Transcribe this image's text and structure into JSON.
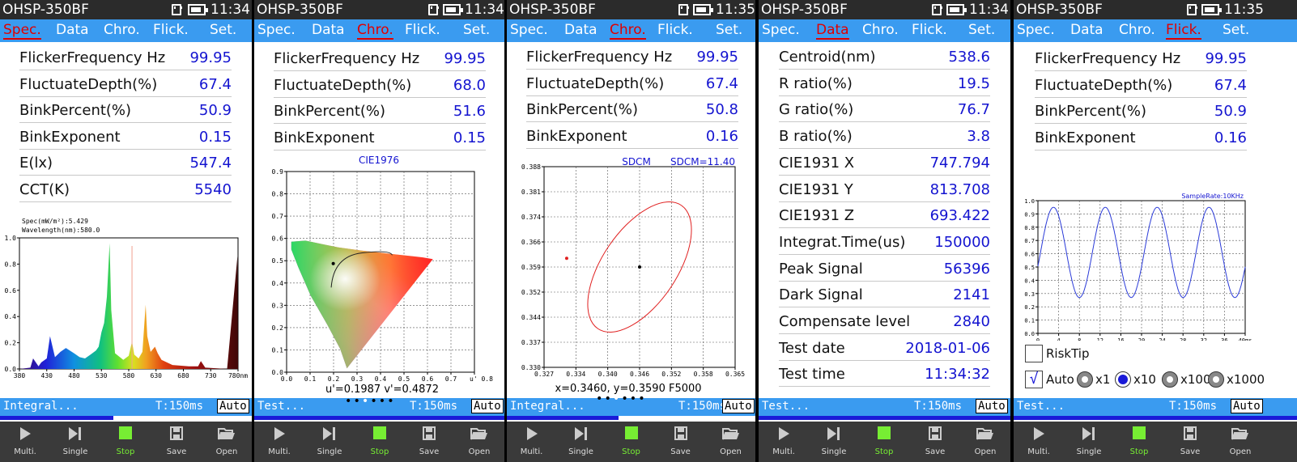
{
  "device_name": "OHSP-350BF",
  "screens": [
    {
      "time": "11:34",
      "tabs": [
        "Spec.",
        "Data",
        "Chro.",
        "Flick.",
        "Set."
      ],
      "active_tab": 0,
      "rows": [
        {
          "label": "FlickerFrequency Hz",
          "value": "99.95"
        },
        {
          "label": "FluctuateDepth(%)",
          "value": "67.4"
        },
        {
          "label": "BinkPercent(%)",
          "value": "50.9"
        },
        {
          "label": "BinkExponent",
          "value": "0.15"
        },
        {
          "label": "E(lx)",
          "value": "547.4"
        },
        {
          "label": "CCT(K)",
          "value": "5540"
        }
      ],
      "status": "Integral...",
      "time_label": "T:150ms",
      "auto_label": "Auto",
      "progress": 0.45
    },
    {
      "time": "11:34",
      "tabs": [
        "Spec.",
        "Data",
        "Chro.",
        "Flick.",
        "Set."
      ],
      "active_tab": 2,
      "rows": [
        {
          "label": "FlickerFrequency Hz",
          "value": "99.95"
        },
        {
          "label": "FluctuateDepth(%)",
          "value": "68.0"
        },
        {
          "label": "BinkPercent(%)",
          "value": "51.6"
        },
        {
          "label": "BinkExponent",
          "value": "0.15"
        }
      ],
      "status": "Test...",
      "time_label": "T:150ms",
      "auto_label": "Auto",
      "progress": 1.0
    },
    {
      "time": "11:35",
      "tabs": [
        "Spec.",
        "Data",
        "Chro.",
        "Flick.",
        "Set."
      ],
      "active_tab": 2,
      "rows": [
        {
          "label": "FlickerFrequency Hz",
          "value": "99.95"
        },
        {
          "label": "FluctuateDepth(%)",
          "value": "67.4"
        },
        {
          "label": "BinkPercent(%)",
          "value": "50.8"
        },
        {
          "label": "BinkExponent",
          "value": "0.16"
        }
      ],
      "status": "Integral...",
      "time_label": "T:150ms",
      "auto_label": "Auto",
      "progress": 0.45
    },
    {
      "time": "11:34",
      "tabs": [
        "Spec.",
        "Data",
        "Chro.",
        "Flick.",
        "Set."
      ],
      "active_tab": 1,
      "rows": [
        {
          "label": "Centroid(nm)",
          "value": "538.6"
        },
        {
          "label": "R ratio(%)",
          "value": "19.5"
        },
        {
          "label": "G ratio(%)",
          "value": "76.7"
        },
        {
          "label": "B ratio(%)",
          "value": "3.8"
        },
        {
          "label": "CIE1931 X",
          "value": "747.794"
        },
        {
          "label": "CIE1931 Y",
          "value": "813.708"
        },
        {
          "label": "CIE1931 Z",
          "value": "693.422"
        },
        {
          "label": "Integrat.Time(us)",
          "value": "150000"
        },
        {
          "label": "Peak Signal",
          "value": "56396"
        },
        {
          "label": "Dark Signal",
          "value": "2141"
        },
        {
          "label": "Compensate level",
          "value": "2840"
        },
        {
          "label": "Test date",
          "value": "2018-01-06"
        },
        {
          "label": "Test time",
          "value": "11:34:32"
        }
      ],
      "status": "Test...",
      "time_label": "T:150ms",
      "auto_label": "Auto",
      "progress": 1.0
    },
    {
      "time": "11:35",
      "tabs": [
        "Spec.",
        "Data",
        "Chro.",
        "Flick.",
        "Set."
      ],
      "active_tab": 3,
      "rows": [
        {
          "label": "FlickerFrequency Hz",
          "value": "99.95"
        },
        {
          "label": "FluctuateDepth(%)",
          "value": "67.4"
        },
        {
          "label": "BinkPercent(%)",
          "value": "50.9"
        },
        {
          "label": "BinkExponent",
          "value": "0.16"
        }
      ],
      "status": "Test...",
      "time_label": "T:150ms",
      "auto_label": "Auto",
      "progress": 1.0,
      "risk_tip_label": "RiskTip",
      "auto_check_label": "Auto",
      "check_mark": "√",
      "zoom_options": [
        "x1",
        "x10",
        "x100",
        "x1000"
      ],
      "zoom_selected": 1
    }
  ],
  "toolbar": [
    {
      "label": "Multi.",
      "icon": "play-icon"
    },
    {
      "label": "Single",
      "icon": "step-icon"
    },
    {
      "label": "Stop",
      "icon": "stop-icon"
    },
    {
      "label": "Save",
      "icon": "save-icon"
    },
    {
      "label": "Open",
      "icon": "folder-open-icon"
    }
  ],
  "page_dots": [
    "•",
    "•",
    "•",
    "•",
    "•",
    "•"
  ],
  "page_dots_active": 2,
  "colors": {
    "tab_bar": "#3a9bf0",
    "active_tab": "#e00000",
    "value_text": "#1414d0",
    "stop_icon": "#77ee33",
    "flicker_curve": "#2a3ad8",
    "sdcm_ellipse": "#e02020"
  },
  "chart_data": [
    {
      "type": "line",
      "kind": "spectrum",
      "annotations": [
        "Spec(mW/m²):5.429",
        "Wavelength(nm):580.0"
      ],
      "x_ticks": [
        "380",
        "430",
        "480",
        "530",
        "580",
        "630",
        "680",
        "730",
        "780nm"
      ],
      "y_ticks": [
        "0.0",
        "0.2",
        "0.4",
        "0.6",
        "0.8",
        "1.0"
      ],
      "xlim": [
        380,
        780
      ],
      "ylim": [
        0,
        1.0
      ],
      "x": [
        380,
        400,
        405,
        415,
        420,
        430,
        436,
        445,
        455,
        465,
        480,
        490,
        500,
        510,
        520,
        525,
        530,
        535,
        540,
        545,
        548,
        555,
        570,
        580,
        586,
        590,
        598,
        605,
        611,
        614,
        620,
        628,
        633,
        640,
        660,
        690,
        707,
        712,
        720,
        760,
        779,
        780
      ],
      "y": [
        0.0,
        0.01,
        0.08,
        0.02,
        0.05,
        0.08,
        0.25,
        0.09,
        0.13,
        0.16,
        0.12,
        0.09,
        0.08,
        0.11,
        0.14,
        0.17,
        0.28,
        0.35,
        0.55,
        0.96,
        0.45,
        0.12,
        0.07,
        0.1,
        0.21,
        0.11,
        0.08,
        0.13,
        0.49,
        0.25,
        0.13,
        0.17,
        0.12,
        0.07,
        0.03,
        0.02,
        0.02,
        0.06,
        0.01,
        0.0,
        0.86,
        0.0
      ]
    },
    {
      "type": "scatter",
      "kind": "cie1976",
      "title": "CIE1976",
      "x_ticks": [
        "0.0",
        "0.1",
        "0.2",
        "0.3",
        "0.4",
        "0.5",
        "0.6",
        "0.7"
      ],
      "x_ticks_end": "u' 0.8",
      "y_ticks": [
        "0.0",
        "0.1",
        "0.2",
        "0.3",
        "0.4",
        "0.5",
        "0.6",
        "0.7",
        "0.8",
        "0.9"
      ],
      "xlim": [
        0,
        0.8
      ],
      "ylim": [
        0,
        0.9
      ],
      "point": {
        "u": 0.1987,
        "v": 0.4872
      },
      "caption": "u'=0.1987  v'=0.4872",
      "locus": [
        [
          0.257,
          0.017
        ],
        [
          0.228,
          0.105
        ],
        [
          0.172,
          0.215
        ],
        [
          0.102,
          0.344
        ],
        [
          0.05,
          0.47
        ],
        [
          0.02,
          0.55
        ],
        [
          0.02,
          0.585
        ],
        [
          0.08,
          0.59
        ],
        [
          0.15,
          0.575
        ],
        [
          0.22,
          0.56
        ],
        [
          0.32,
          0.545
        ],
        [
          0.45,
          0.53
        ],
        [
          0.58,
          0.515
        ],
        [
          0.623,
          0.507
        ]
      ]
    },
    {
      "type": "scatter",
      "kind": "sdcm",
      "title": "SDCM",
      "sdcm_label": "SDCM=11.40",
      "x_ticks": [
        "0.327",
        "0.334",
        "0.340",
        "0.346",
        "0.352",
        "0.358",
        "0.365"
      ],
      "y_ticks": [
        "0.388",
        "0.381",
        "0.374",
        "0.366",
        "0.359",
        "0.352",
        "0.344",
        "0.337",
        "0.330"
      ],
      "xlim": [
        0.327,
        0.365
      ],
      "ylim": [
        0.33,
        0.388
      ],
      "center": {
        "x": 0.346,
        "y": 0.359
      },
      "measured": {
        "x": 0.3315,
        "y": 0.3615
      },
      "caption": "x=0.3460, y=0.3590 F5000"
    },
    {
      "type": "line",
      "kind": "flicker",
      "sample_rate": "SampleRate:10KHz",
      "x_ticks": [
        "0",
        "4",
        "8",
        "12",
        "16",
        "20",
        "24",
        "28",
        "32",
        "36",
        "40ms"
      ],
      "y_ticks": [
        "0.0",
        "0.1",
        "0.2",
        "0.3",
        "0.4",
        "0.5",
        "0.6",
        "0.7",
        "0.8",
        "0.9",
        "1.0"
      ],
      "xlim": [
        0,
        40
      ],
      "ylim": [
        0,
        1.0
      ],
      "mean": 0.61,
      "amplitude": 0.34,
      "frequency_hz": 99.95,
      "phase_ms": 0.5
    }
  ]
}
